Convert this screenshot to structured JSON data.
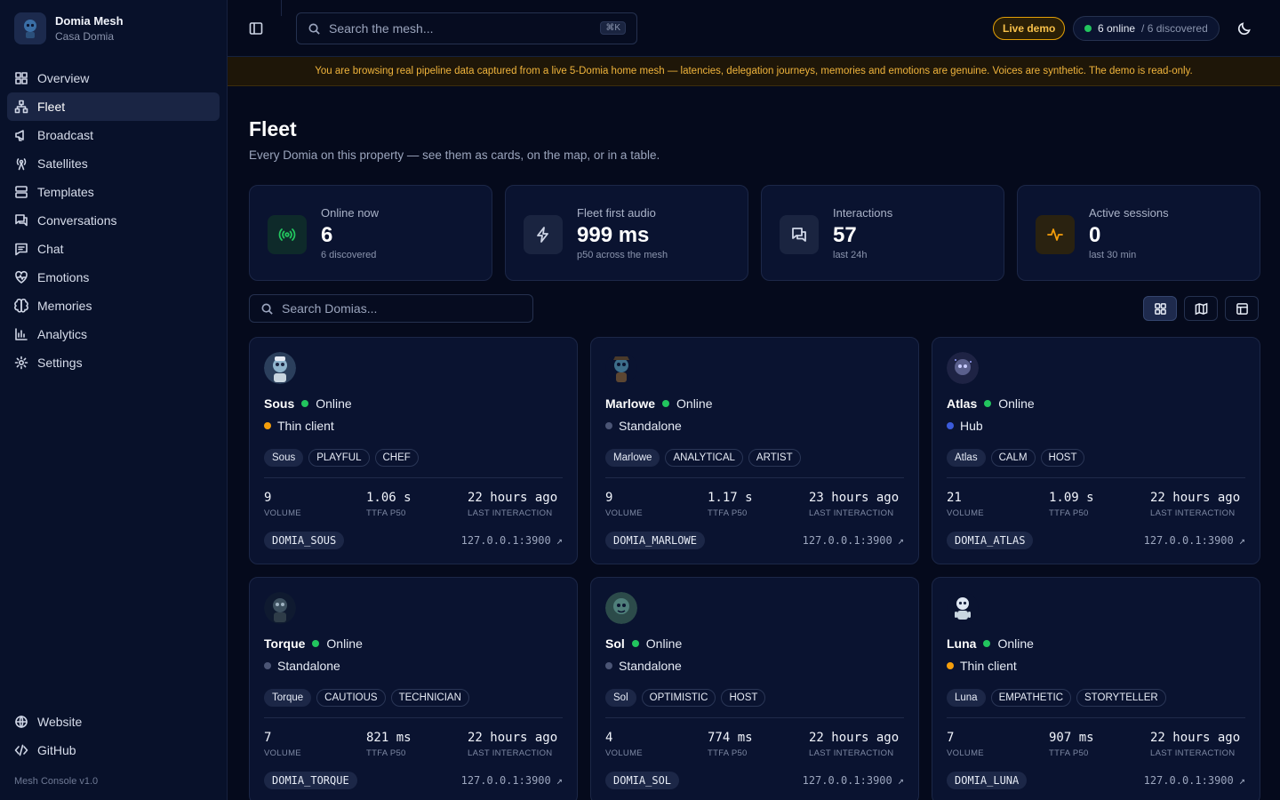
{
  "brand": {
    "title": "Domia Mesh",
    "subtitle": "Casa Domia"
  },
  "nav": [
    {
      "label": "Overview",
      "icon": "grid-icon"
    },
    {
      "label": "Fleet",
      "icon": "network-icon",
      "active": true
    },
    {
      "label": "Broadcast",
      "icon": "megaphone-icon"
    },
    {
      "label": "Satellites",
      "icon": "radio-tower-icon"
    },
    {
      "label": "Templates",
      "icon": "templates-icon"
    },
    {
      "label": "Conversations",
      "icon": "messages-icon"
    },
    {
      "label": "Chat",
      "icon": "chat-icon"
    },
    {
      "label": "Emotions",
      "icon": "heart-pulse-icon"
    },
    {
      "label": "Memories",
      "icon": "brain-icon"
    },
    {
      "label": "Analytics",
      "icon": "chart-icon"
    },
    {
      "label": "Settings",
      "icon": "gear-icon"
    }
  ],
  "nav_bottom": [
    {
      "label": "Website",
      "icon": "globe-icon"
    },
    {
      "label": "GitHub",
      "icon": "code-icon"
    }
  ],
  "version": "Mesh Console v1.0",
  "topbar": {
    "search_placeholder": "Search the mesh...",
    "shortcut": "⌘K",
    "live_badge": "Live demo",
    "online": "6 online",
    "discovered": "/ 6 discovered"
  },
  "banner": "You are browsing real pipeline data captured from a live 5-Domia home mesh — latencies, delegation journeys, memories and emotions are genuine. Voices are synthetic. The demo is read-only.",
  "page": {
    "title": "Fleet",
    "subtitle": "Every Domia on this property — see them as cards, on the map, or in a table."
  },
  "stats": [
    {
      "label": "Online now",
      "value": "6",
      "sub": "6 discovered",
      "icon": "radio-waves-icon",
      "color": "#22c55e"
    },
    {
      "label": "Fleet first audio",
      "value": "999 ms",
      "sub": "p50 across the mesh",
      "icon": "bolt-icon",
      "color": "#cfd6e6"
    },
    {
      "label": "Interactions",
      "value": "57",
      "sub": "last 24h",
      "icon": "messages-icon",
      "color": "#cfd6e6"
    },
    {
      "label": "Active sessions",
      "value": "0",
      "sub": "last 30 min",
      "icon": "activity-icon",
      "color": "#f59e0b"
    }
  ],
  "fleet_search_placeholder": "Search Domias...",
  "metric_labels": {
    "volume": "VOLUME",
    "ttfa": "TTFA P50",
    "last": "LAST INTERACTION"
  },
  "cards": [
    {
      "name": "Sous",
      "status": "Online",
      "role": "Thin client",
      "role_color": "#f59e0b",
      "tags": [
        "Sous",
        "PLAYFUL",
        "CHEF"
      ],
      "volume": "9",
      "ttfa": "1.06 s",
      "last": "22 hours ago",
      "id": "DOMIA_SOUS",
      "addr": "127.0.0.1:3900"
    },
    {
      "name": "Marlowe",
      "status": "Online",
      "role": "Standalone",
      "role_color": "#4b5575",
      "tags": [
        "Marlowe",
        "ANALYTICAL",
        "ARTIST"
      ],
      "volume": "9",
      "ttfa": "1.17 s",
      "last": "23 hours ago",
      "id": "DOMIA_MARLOWE",
      "addr": "127.0.0.1:3900"
    },
    {
      "name": "Atlas",
      "status": "Online",
      "role": "Hub",
      "role_color": "#3b5bdb",
      "tags": [
        "Atlas",
        "CALM",
        "HOST"
      ],
      "volume": "21",
      "ttfa": "1.09 s",
      "last": "22 hours ago",
      "id": "DOMIA_ATLAS",
      "addr": "127.0.0.1:3900"
    },
    {
      "name": "Torque",
      "status": "Online",
      "role": "Standalone",
      "role_color": "#4b5575",
      "tags": [
        "Torque",
        "CAUTIOUS",
        "TECHNICIAN"
      ],
      "volume": "7",
      "ttfa": "821 ms",
      "last": "22 hours ago",
      "id": "DOMIA_TORQUE",
      "addr": "127.0.0.1:3900"
    },
    {
      "name": "Sol",
      "status": "Online",
      "role": "Standalone",
      "role_color": "#4b5575",
      "tags": [
        "Sol",
        "OPTIMISTIC",
        "HOST"
      ],
      "volume": "4",
      "ttfa": "774 ms",
      "last": "22 hours ago",
      "id": "DOMIA_SOL",
      "addr": "127.0.0.1:3900"
    },
    {
      "name": "Luna",
      "status": "Online",
      "role": "Thin client",
      "role_color": "#f59e0b",
      "tags": [
        "Luna",
        "EMPATHETIC",
        "STORYTELLER"
      ],
      "volume": "7",
      "ttfa": "907 ms",
      "last": "22 hours ago",
      "id": "DOMIA_LUNA",
      "addr": "127.0.0.1:3900"
    }
  ]
}
